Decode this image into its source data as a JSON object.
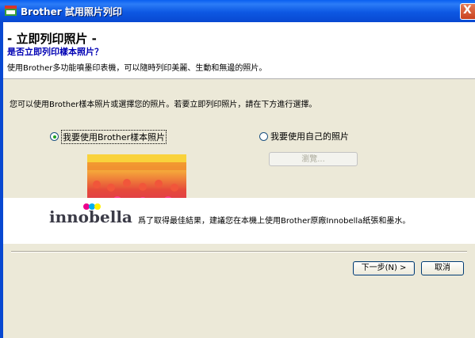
{
  "window": {
    "title": "Brother 試用照片列印",
    "close_glyph": "X"
  },
  "header": {
    "heading": "- 立即列印照片 -",
    "subheading": "是否立即列印樣本照片？",
    "description": "使用Brother多功能噴墨印表機，可以隨時列印美麗、生動和無邊的照片。"
  },
  "main": {
    "instruction": "您可以使用Brother樣本照片或選擇您的照片。若要立即列印照片，請在下方進行選擇。",
    "options": [
      {
        "label": "我要使用Brother樣本照片",
        "selected": true
      },
      {
        "label": "我要使用自己的照片",
        "selected": false
      }
    ],
    "browse_label": "瀏覽..."
  },
  "footer_band": {
    "logo_text": "innobella",
    "note": "爲了取得最佳結果，建議您在本機上使用Brother原廠Innobella紙張和墨水。"
  },
  "buttons": {
    "next": "下一步(N) >",
    "cancel": "取消"
  },
  "colors": {
    "titlebar": "#0848d1",
    "dialog_bg": "#ece9d8",
    "subheading": "#0000b4"
  }
}
